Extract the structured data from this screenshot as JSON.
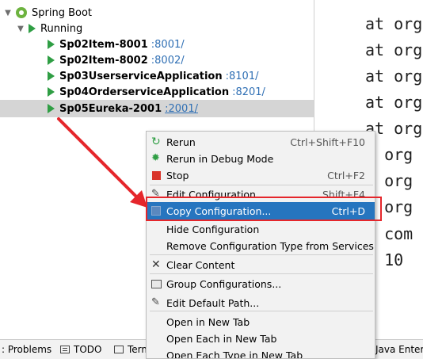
{
  "tree": {
    "root_label": "Spring Boot",
    "running_label": "Running",
    "apps": [
      {
        "name": "Sp02Item-8001",
        "port": ":8001/"
      },
      {
        "name": "Sp02Item-8002",
        "port": ":8002/"
      },
      {
        "name": "Sp03UserserviceApplication",
        "port": ":8101/"
      },
      {
        "name": "Sp04OrderserviceApplication",
        "port": ":8201/"
      },
      {
        "name": "Sp05Eureka-2001",
        "port": ":2001/"
      }
    ]
  },
  "console": {
    "lines": [
      "at org",
      "at org",
      "at org",
      "at org",
      "at org",
      "t org",
      "t org",
      "t org",
      "t com",
      ". 10"
    ]
  },
  "context_menu": {
    "items": [
      {
        "label": "Rerun",
        "shortcut": "Ctrl+Shift+F10",
        "icon": "rerun-icon"
      },
      {
        "label": "Rerun in Debug Mode",
        "shortcut": "",
        "icon": "debug-icon"
      },
      {
        "label": "Stop",
        "shortcut": "Ctrl+F2",
        "icon": "stop-icon"
      },
      {
        "label": "Edit Configuration",
        "shortcut": "Shift+F4",
        "icon": "edit-icon"
      },
      {
        "label": "Copy Configuration...",
        "shortcut": "Ctrl+D",
        "icon": "copy-icon"
      },
      {
        "label": "Hide Configuration",
        "shortcut": "",
        "icon": ""
      },
      {
        "label": "Remove Configuration Type from Services",
        "shortcut": "",
        "icon": ""
      },
      {
        "label": "Clear Content",
        "shortcut": "",
        "icon": "clear-icon"
      },
      {
        "label": "Group Configurations...",
        "shortcut": "",
        "icon": "group-icon"
      },
      {
        "label": "Edit Default Path...",
        "shortcut": "",
        "icon": "pencil-icon"
      },
      {
        "label": "Open in New Tab",
        "shortcut": "",
        "icon": ""
      },
      {
        "label": "Open Each in New Tab",
        "shortcut": "",
        "icon": ""
      },
      {
        "label": "Open Each Type in New Tab",
        "shortcut": "",
        "icon": ""
      }
    ]
  },
  "bottom_tabs": {
    "problems": ": Problems",
    "todo": "TODO",
    "terminal": "Term",
    "java_enterprise": "Java Enterpr"
  },
  "colors": {
    "highlight": "#2675bf",
    "annotation_red": "#e5262b",
    "run_green": "#2f9e44",
    "port_blue": "#2f6fb4"
  }
}
